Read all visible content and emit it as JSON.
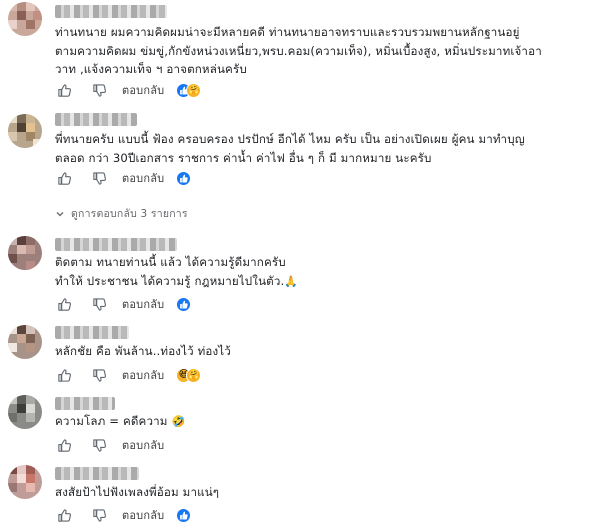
{
  "comments": [
    {
      "text": "ท่านทนาย ผมความคิดผมน่าจะมีหลายคดี ท่านทนายอาจทราบและรวบรวมพยานหลักฐานอยู่\nตามความคิดผม ข่มขู่,กักขังหน่วงเหนี่ยว,พรบ.คอม(ความเท็จ), หมิ่นเบื้องสูง, หมิ่นประมาทเจ้าอา\nวาท ,แจ้งความเท็จ ฯ อาจตกหล่นครับ",
      "reply_label": "ตอบกลับ",
      "reactions": [
        "like-reaction",
        "hug-reaction"
      ]
    },
    {
      "text": "พี่ทนายครับ แบบนี้ ฟ้อง ครอบครอง ปรปักษ์ อีกได้ ไหม ครับ เป็น อย่างเปิดเผย ผู้คน มาทำบุญ\nตลอด กว่า 30ปีเอกสาร ราชการ ค่าน้ำ ค่าไฟ อื่น ๆ ก็ มี มากหมาย นะครับ",
      "reply_label": "ตอบกลับ",
      "reactions": [
        "like-reaction"
      ],
      "view_replies": "ดูการตอบกลับ 3 รายการ"
    },
    {
      "text": "ติดตาม ทนายท่านนี้ แล้ว ได้ความรู้ดีมากครับ\nทำให้ ประชาชน ได้ความรู้ กฎหมายไปในตัว.",
      "trailing_emoji": "🙏",
      "reply_label": "ตอบกลับ",
      "reactions": [
        "like-reaction"
      ]
    },
    {
      "text": "หลักชัย คือ พันล้าน..ท่องไว้ ท่องไว้",
      "reply_label": "ตอบกลับ",
      "reactions": [
        "laugh-reaction",
        "hug-reaction"
      ]
    },
    {
      "text": "ความโลภ = คดีความ",
      "trailing_emoji": "🤣",
      "reply_label": "ตอบกลับ",
      "reactions": []
    },
    {
      "text": "สงสัยป้าไปฟังเพลงพี่อ้อม มาแน่ๆ",
      "reply_label": "ตอบกลับ",
      "reactions": [
        "like-reaction"
      ]
    }
  ],
  "colors": {
    "reaction_like": "#1877f2",
    "reaction_face": "#f7b125",
    "text": "#1c1e21",
    "secondary": "#65676b"
  }
}
